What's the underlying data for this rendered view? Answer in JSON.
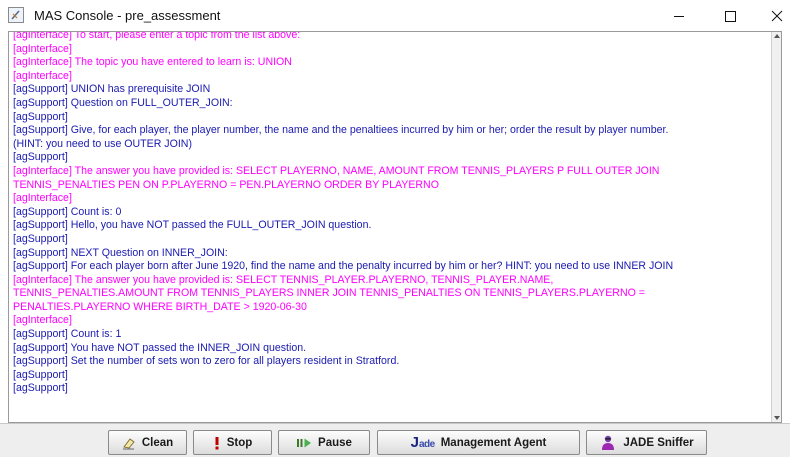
{
  "window": {
    "title": "MAS Console - pre_assessment",
    "controls": {
      "minimize": "—",
      "maximize": "☐",
      "close": "✕"
    }
  },
  "colors": {
    "agInterface": "#ff00ff",
    "agSupport": "#1a1ab0"
  },
  "console": {
    "lines": [
      {
        "agent": "agInterface",
        "text": "[agInterface] To start, please enter a topic from the list above:"
      },
      {
        "agent": "agInterface",
        "text": "[agInterface]"
      },
      {
        "agent": "agInterface",
        "text": "[agInterface] The topic you have entered to learn is: UNION"
      },
      {
        "agent": "agInterface",
        "text": "[agInterface]"
      },
      {
        "agent": "agSupport",
        "text": "[agSupport] UNION has prerequisite JOIN"
      },
      {
        "agent": "agSupport",
        "text": "[agSupport] Question on FULL_OUTER_JOIN:"
      },
      {
        "agent": "agSupport",
        "text": "[agSupport]"
      },
      {
        "agent": "agSupport",
        "text": "[agSupport] Give, for each player, the player number, the name and the penaltiees incurred by him or her; order the result by player number."
      },
      {
        "agent": "agSupport",
        "text": "(HINT: you need to use OUTER JOIN)"
      },
      {
        "agent": "agSupport",
        "text": "[agSupport]"
      },
      {
        "agent": "agInterface",
        "text": "[agInterface] The answer you have provided is: SELECT PLAYERNO, NAME, AMOUNT FROM TENNIS_PLAYERS P FULL OUTER JOIN"
      },
      {
        "agent": "agInterface",
        "text": "TENNIS_PENALTIES PEN ON P.PLAYERNO = PEN.PLAYERNO ORDER BY PLAYERNO"
      },
      {
        "agent": "agInterface",
        "text": "[agInterface]"
      },
      {
        "agent": "agSupport",
        "text": "[agSupport] Count is: 0"
      },
      {
        "agent": "agSupport",
        "text": "[agSupport] Hello, you have NOT passed the FULL_OUTER_JOIN question."
      },
      {
        "agent": "agSupport",
        "text": "[agSupport]"
      },
      {
        "agent": "agSupport",
        "text": "[agSupport] NEXT Question on INNER_JOIN:"
      },
      {
        "agent": "agSupport",
        "text": "[agSupport] For each player born after June 1920, find the name and the penalty incurred by him or her? HINT: you need to use INNER JOIN"
      },
      {
        "agent": "agInterface",
        "text": "[agInterface] The answer you have provided is: SELECT TENNIS_PLAYER.PLAYERNO, TENNIS_PLAYER.NAME,"
      },
      {
        "agent": "agInterface",
        "text": "TENNIS_PENALTIES.AMOUNT FROM TENNIS_PLAYERS INNER JOIN TENNIS_PENALTIES ON TENNIS_PLAYERS.PLAYERNO ="
      },
      {
        "agent": "agInterface",
        "text": "PENALTIES.PLAYERNO WHERE BIRTH_DATE > 1920-06-30"
      },
      {
        "agent": "agInterface",
        "text": "[agInterface]"
      },
      {
        "agent": "agSupport",
        "text": "[agSupport] Count is: 1"
      },
      {
        "agent": "agSupport",
        "text": "[agSupport] You have NOT passed the INNER_JOIN question."
      },
      {
        "agent": "agSupport",
        "text": "[agSupport] Set the number of sets won to zero for all players resident in Stratford."
      },
      {
        "agent": "agSupport",
        "text": "[agSupport]"
      },
      {
        "agent": "agSupport",
        "text": "[agSupport]"
      }
    ]
  },
  "toolbar": {
    "clean": {
      "label": "Clean",
      "icon": "eraser-icon"
    },
    "stop": {
      "label": "Stop",
      "icon": "exclamation-icon"
    },
    "pause": {
      "label": "Pause",
      "icon": "pause-play-icon"
    },
    "management_agent": {
      "label": "Management Agent",
      "logo_j": "J",
      "logo_rest": "ade",
      "icon": "jade-logo-icon"
    },
    "sniffer": {
      "label": "JADE Sniffer",
      "icon": "sniffer-agent-icon"
    }
  }
}
